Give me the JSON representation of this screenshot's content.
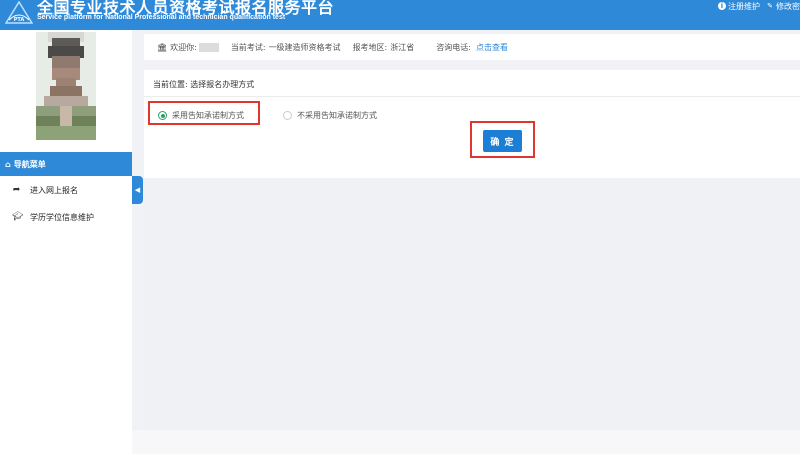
{
  "header": {
    "title_cn": "全国专业技术人员资格考试报名服务平台",
    "title_en": "Service platform for National Professional and technician qualification test",
    "logo_text": "PTA",
    "links": [
      {
        "label": "注册维护",
        "icon": "info-icon"
      },
      {
        "label": "修改密",
        "icon": "edit-icon"
      }
    ]
  },
  "sidebar": {
    "nav_title": "导航菜单",
    "items": [
      {
        "label": "进入网上报名",
        "icon": "share-arrow-icon"
      },
      {
        "label": "学历学位信息维护",
        "icon": "graduation-cap-icon"
      }
    ]
  },
  "info_bar": {
    "welcome_label": "欢迎你:",
    "exam_label": "当前考试:",
    "exam_value": "一级建造师资格考试",
    "region_label": "报考地区:",
    "region_value": "浙江省",
    "phone_label": "咨询电话:",
    "phone_link": "点击查看"
  },
  "main": {
    "breadcrumb": "当前位置: 选择报名办理方式",
    "options": [
      {
        "label": "采用告知承诺制方式",
        "checked": true
      },
      {
        "label": "不采用告知承诺制方式",
        "checked": false
      }
    ],
    "confirm_label": "确 定"
  },
  "colors": {
    "primary": "#2e89d9",
    "button": "#1c7ed4",
    "highlight": "#e0362d",
    "radio_checked": "#2e9e6a"
  }
}
